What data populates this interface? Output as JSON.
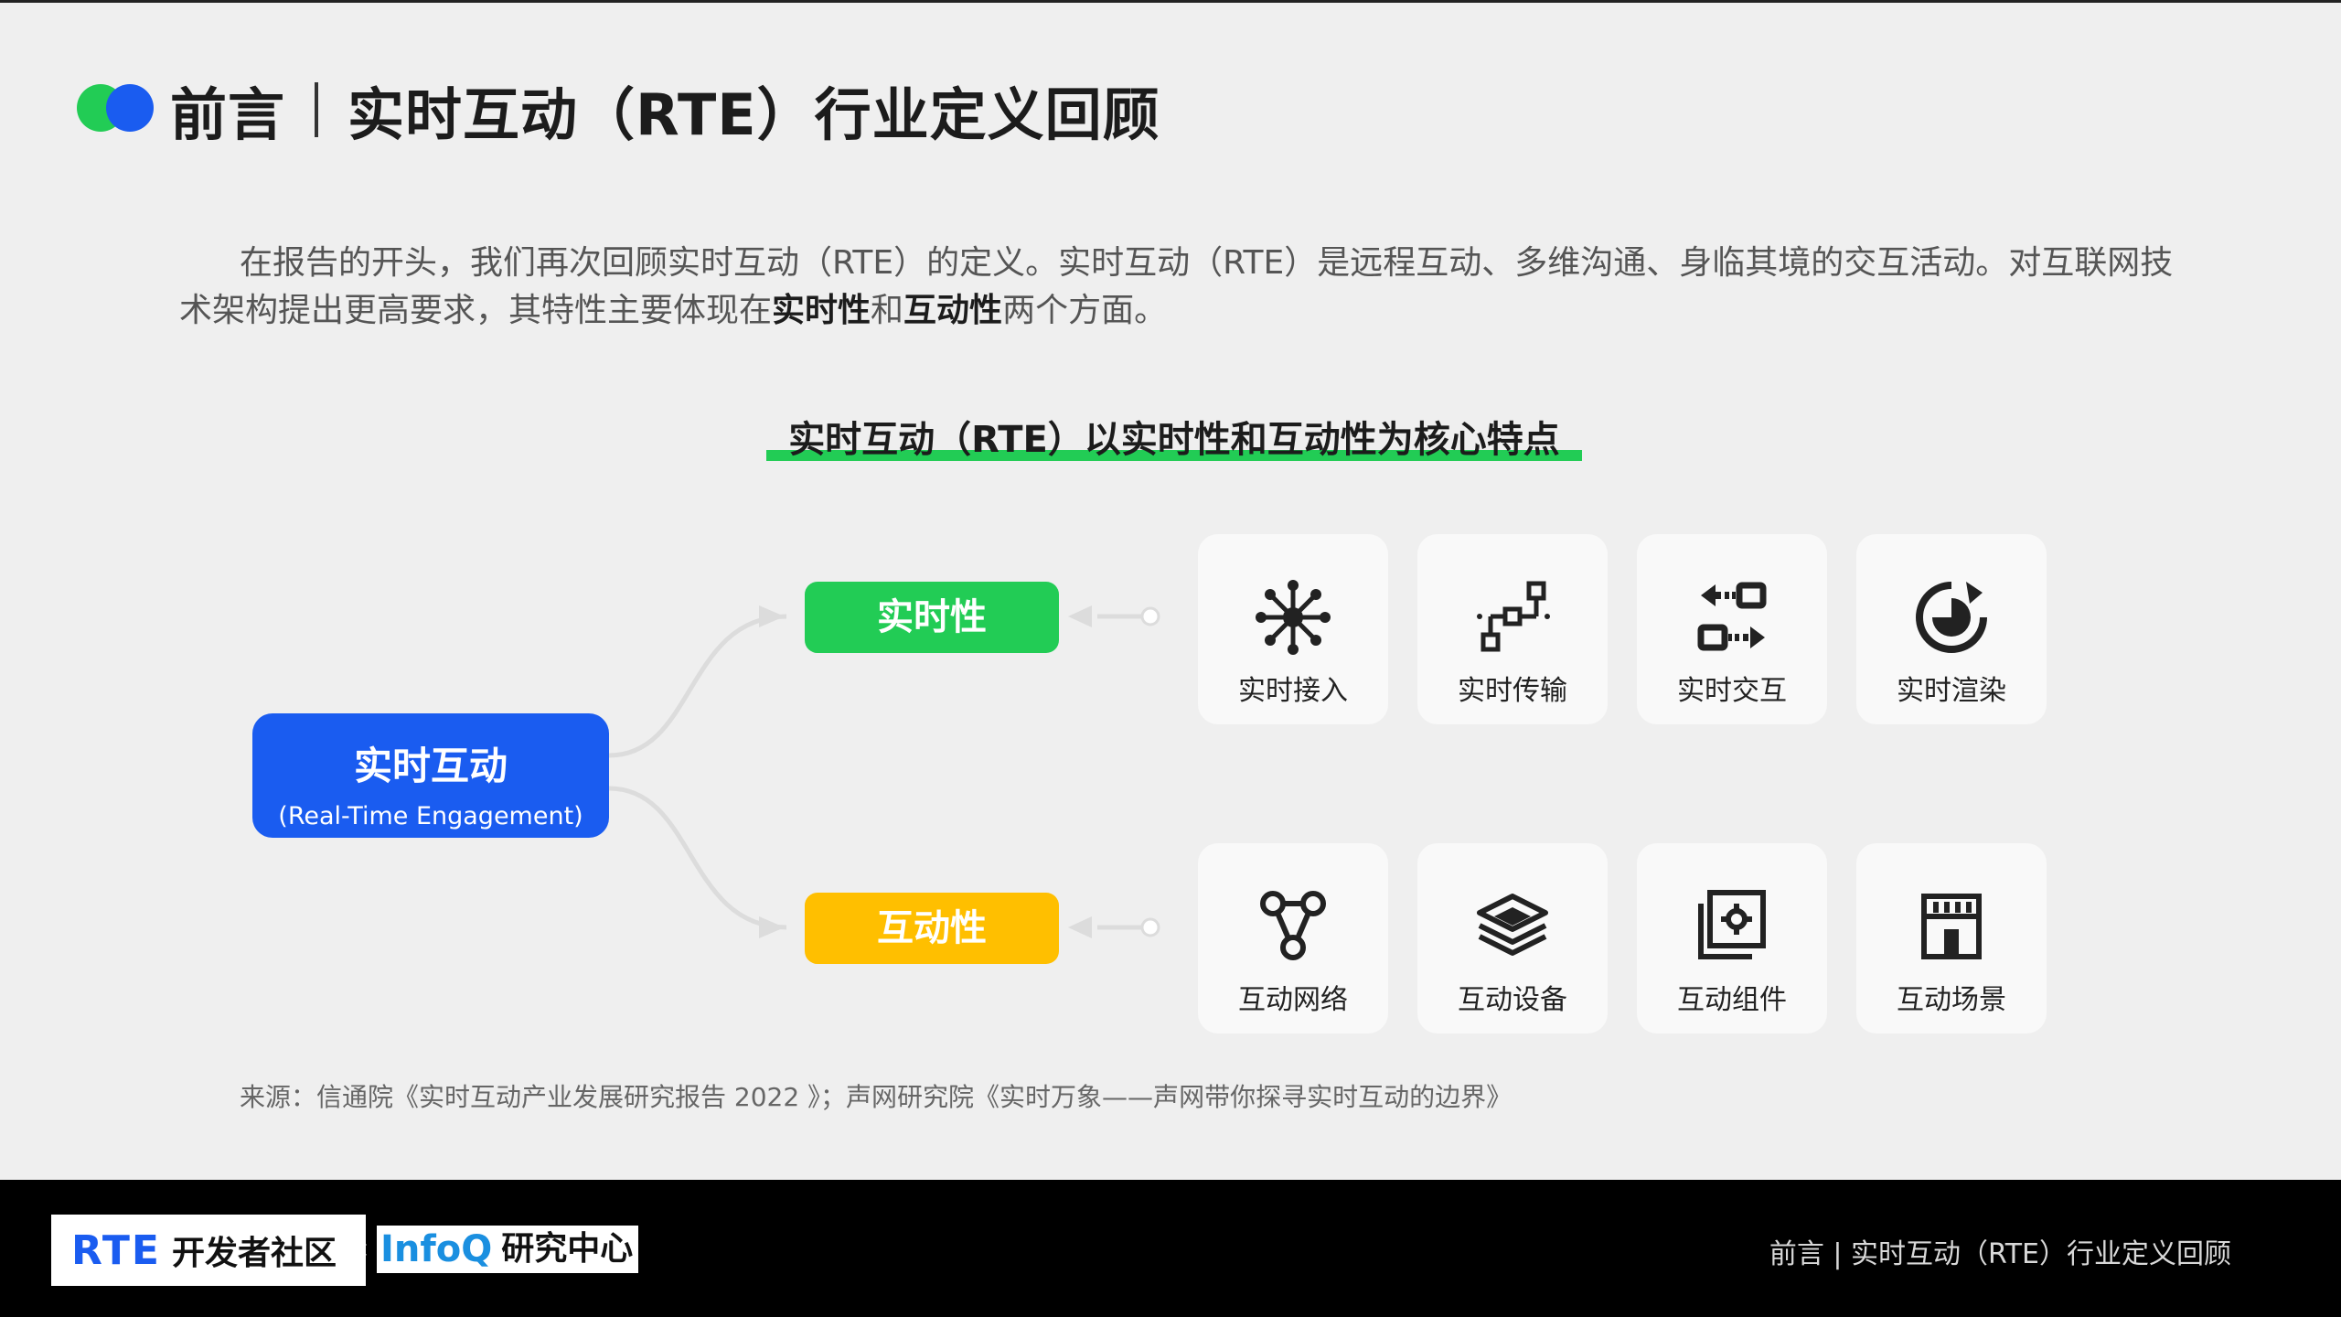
{
  "header": {
    "title_left": "前言",
    "title_right": "实时互动（RTE）行业定义回顾"
  },
  "intro": {
    "text_a": "在报告的开头，我们再次回顾实时互动（RTE）的定义。实时互动（RTE）是远程互动、多维沟通、身临其境的交互活动。对互联网技术架构提出更高要求，其特性主要体现在",
    "bold_1": "实时性",
    "text_b": "和",
    "bold_2": "互动性",
    "text_c": "两个方面。"
  },
  "diagram": {
    "subtitle": "实时互动（RTE）以实时性和互动性为核心特点",
    "root_label": "实时互动",
    "root_sub": "(Real-Time Engagement)",
    "branch_realtime": "实时性",
    "branch_interactive": "互动性",
    "realtime_items": [
      {
        "label": "实时接入",
        "icon": "network-hub-icon"
      },
      {
        "label": "实时传输",
        "icon": "transfer-nodes-icon"
      },
      {
        "label": "实时交互",
        "icon": "exchange-arrows-icon"
      },
      {
        "label": "实时渲染",
        "icon": "render-cycle-icon"
      }
    ],
    "interactive_items": [
      {
        "label": "互动网络",
        "icon": "linked-nodes-icon"
      },
      {
        "label": "互动设备",
        "icon": "device-stack-icon"
      },
      {
        "label": "互动组件",
        "icon": "component-gear-icon"
      },
      {
        "label": "互动场景",
        "icon": "storefront-icon"
      }
    ]
  },
  "source": "来源：信通院《实时互动产业发展研究报告 2022 》；声网研究院《实时万象——声网带你探寻实时互动的边界》",
  "footer": {
    "rte_logo": "RTE",
    "rte_community": "开发者社区",
    "times": "×",
    "infoq_logo": "InfoQ",
    "infoq_center": "研究中心",
    "page_title": "前言 | 实时互动（RTE）行业定义回顾"
  },
  "colors": {
    "green": "#22cc55",
    "blue": "#1a5cf0",
    "yellow": "#ffbf00",
    "background": "#efefef"
  }
}
